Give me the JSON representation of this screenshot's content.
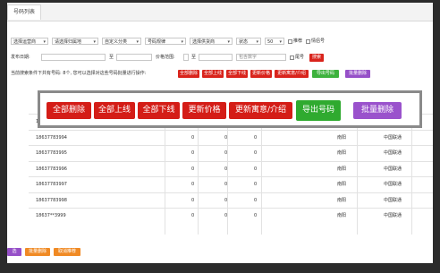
{
  "tab": {
    "label": "号码列表"
  },
  "filters": {
    "selects": [
      "选择运营商",
      "请选择归属地",
      "自定义分类",
      "号码规律",
      "选择供货商",
      "状态",
      "50"
    ],
    "recommend_label": "推荐",
    "love_label": "情侣号",
    "publish_date_label": "发布日期:",
    "to_label": "至",
    "price_range_label": "价格范围:",
    "to_label2": "至",
    "contains_placeholder": "包含数字",
    "tail_label": "尾号",
    "search_button": "搜索"
  },
  "summary": {
    "text": "当前搜索条件下共有号码: 8个, 您可以选择对这些号码批量进行操作:",
    "small_buttons": [
      "全部删除",
      "全部上线",
      "全部下线",
      "更新价格",
      "更新寓意/介绍",
      "导出号码",
      "批量删除"
    ]
  },
  "overlay": {
    "buttons": [
      "全部删除",
      "全部上线",
      "全部下线",
      "更新价格",
      "更新寓意/介绍",
      "导出号码",
      "批量删除"
    ]
  },
  "table": {
    "rows": [
      {
        "number": "18637783993",
        "c1": "0",
        "c2": "0",
        "c3": "0",
        "city": "南阳",
        "carrier": "中国联通",
        "tail": "南阳"
      },
      {
        "number": "18637783994",
        "c1": "0",
        "c2": "0",
        "c3": "0",
        "city": "南阳",
        "carrier": "中国联通",
        "tail": "南阳"
      },
      {
        "number": "18637783995",
        "c1": "0",
        "c2": "0",
        "c3": "0",
        "city": "南阳",
        "carrier": "中国联通",
        "tail": "南阳"
      },
      {
        "number": "18637783996",
        "c1": "0",
        "c2": "0",
        "c3": "0",
        "city": "南阳",
        "carrier": "中国联通",
        "tail": "南阳"
      },
      {
        "number": "18637783997",
        "c1": "0",
        "c2": "0",
        "c3": "0",
        "city": "南阳",
        "carrier": "中国联通",
        "tail": "南阳"
      },
      {
        "number": "18637783998",
        "c1": "0",
        "c2": "0",
        "c3": "0",
        "city": "南阳",
        "carrier": "中国联通",
        "tail": "南阳"
      },
      {
        "number": "18637**3999",
        "c1": "0",
        "c2": "0",
        "c3": "0",
        "city": "南阳",
        "carrier": "中国联通",
        "tail": "南阳"
      }
    ]
  },
  "footer": {
    "buttons": [
      "选",
      "批量删除",
      "取消推荐"
    ]
  },
  "colors": {
    "red": "#d9241c",
    "green": "#3db23d",
    "purple": "#9650c8",
    "orange": "#f08a24"
  }
}
